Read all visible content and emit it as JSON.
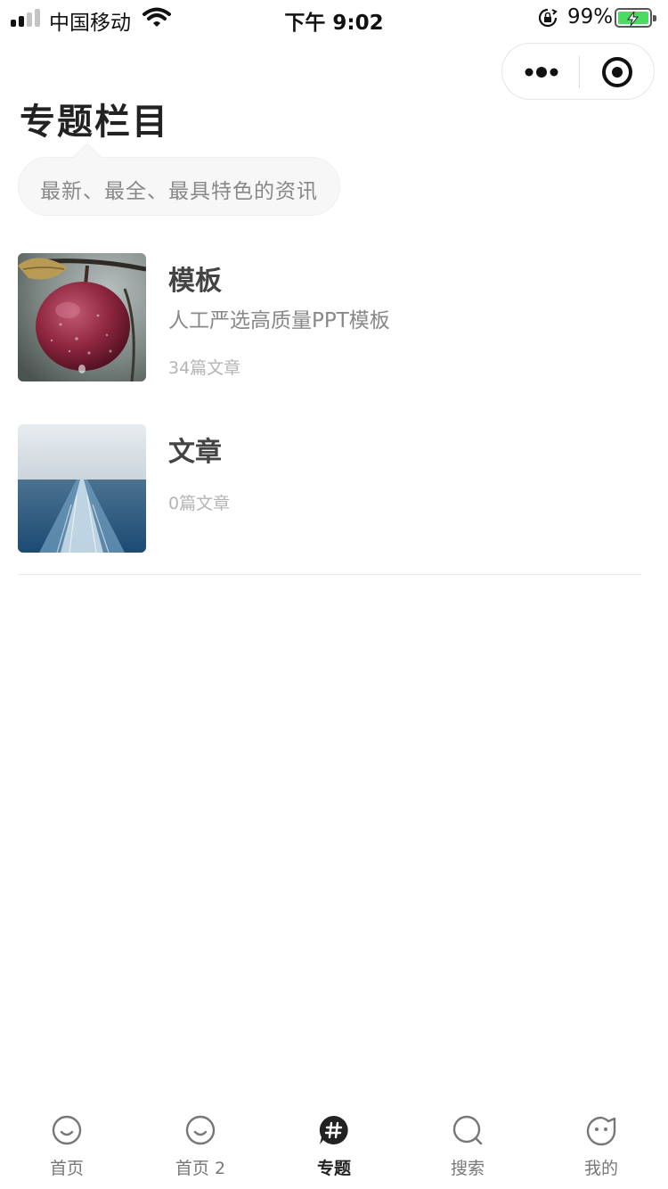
{
  "status_bar": {
    "carrier": "中国移动",
    "time": "下午 9:02",
    "battery": "99%",
    "battery_level": 0.99,
    "signal_bars": 2
  },
  "header": {
    "title": "专题栏目",
    "tagline": "最新、最全、最具特色的资讯"
  },
  "topics": [
    {
      "name": "模板",
      "description": "人工严选高质量PPT模板",
      "count": "34篇文章",
      "thumbnail": "apple-image"
    },
    {
      "name": "文章",
      "description": "",
      "count": "0篇文章",
      "thumbnail": "ocean-wake-image"
    }
  ],
  "tab_bar": {
    "active": "专题",
    "items": [
      {
        "label": "首页",
        "icon": "smile-face-icon"
      },
      {
        "label": "首页 2",
        "icon": "smile-face-icon"
      },
      {
        "label": "专题",
        "icon": "hashtag-bubble-icon"
      },
      {
        "label": "搜索",
        "icon": "search-bubble-icon"
      },
      {
        "label": "我的",
        "icon": "cat-face-icon"
      }
    ]
  },
  "colors": {
    "text_primary": "#222222",
    "text_secondary": "#888888",
    "battery_green": "#4cd964",
    "tab_inactive": "#777777"
  }
}
